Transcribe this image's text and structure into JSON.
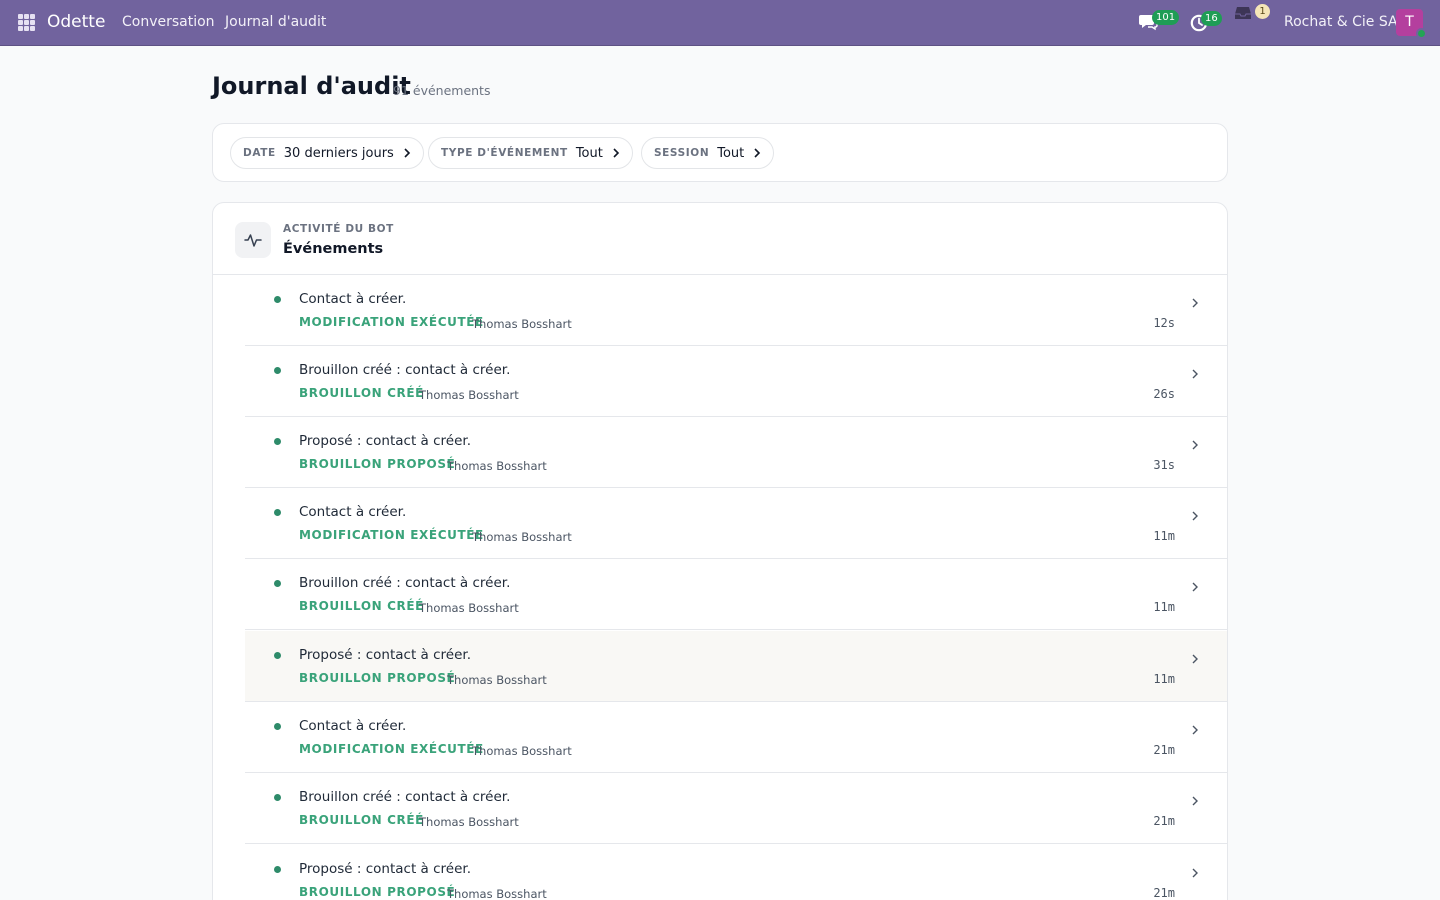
{
  "navbar": {
    "brand": "Odette",
    "links": [
      "Conversation",
      "Journal d'audit"
    ],
    "chat_badge": "101",
    "activity_badge": "16",
    "inbox_badge": "1",
    "company": "Rochat & Cie SA",
    "avatar_initial": "T"
  },
  "page": {
    "title": "Journal d'audit",
    "count": "91 événements"
  },
  "filters": [
    {
      "label": "DATE",
      "value": "30 derniers jours"
    },
    {
      "label": "TYPE D'ÉVÉNEMENT",
      "value": "Tout"
    },
    {
      "label": "SESSION",
      "value": "Tout"
    }
  ],
  "events_panel": {
    "kicker": "ACTIVITÉ DU BOT",
    "title": "Événements"
  },
  "events": [
    {
      "desc": "Contact à créer.",
      "type": "MODIFICATION EXÉCUTÉE",
      "user": "Thomas Bosshart",
      "time": "12s"
    },
    {
      "desc": "Brouillon créé : contact à créer.",
      "type": "BROUILLON CRÉÉ",
      "user": "Thomas Bosshart",
      "time": "26s"
    },
    {
      "desc": "Proposé : contact à créer.",
      "type": "BROUILLON PROPOSÉ",
      "user": "Thomas Bosshart",
      "time": "31s"
    },
    {
      "desc": "Contact à créer.",
      "type": "MODIFICATION EXÉCUTÉE",
      "user": "Thomas Bosshart",
      "time": "11m"
    },
    {
      "desc": "Brouillon créé : contact à créer.",
      "type": "BROUILLON CRÉÉ",
      "user": "Thomas Bosshart",
      "time": "11m"
    },
    {
      "desc": "Proposé : contact à créer.",
      "type": "BROUILLON PROPOSÉ",
      "user": "Thomas Bosshart",
      "time": "11m"
    },
    {
      "desc": "Contact à créer.",
      "type": "MODIFICATION EXÉCUTÉE",
      "user": "Thomas Bosshart",
      "time": "21m"
    },
    {
      "desc": "Brouillon créé : contact à créer.",
      "type": "BROUILLON CRÉÉ",
      "user": "Thomas Bosshart",
      "time": "21m"
    },
    {
      "desc": "Proposé : contact à créer.",
      "type": "BROUILLON PROPOSÉ",
      "user": "Thomas Bosshart",
      "time": "21m"
    }
  ]
}
